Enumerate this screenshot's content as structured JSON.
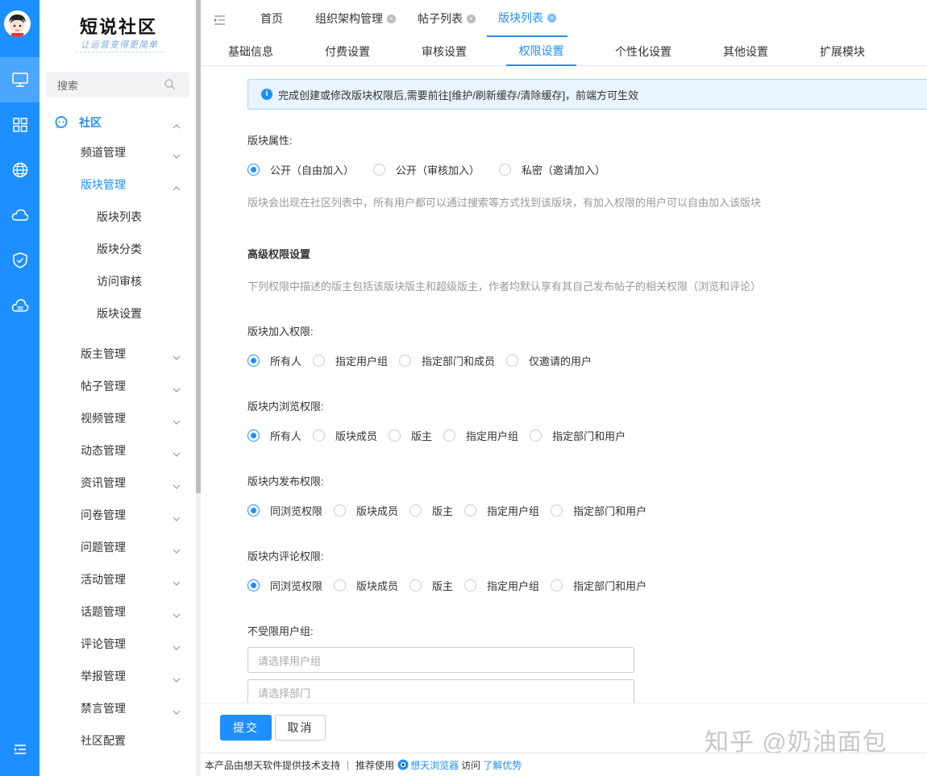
{
  "logo": {
    "title": "短说社区",
    "slogan": "让运营变得更简单"
  },
  "search": {
    "placeholder": "搜索"
  },
  "sidebar": {
    "section_label": "社区",
    "items": [
      {
        "label": "频道管理"
      },
      {
        "label": "版块管理"
      },
      {
        "label": "版块列表"
      },
      {
        "label": "版块分类"
      },
      {
        "label": "访问审核"
      },
      {
        "label": "版块设置"
      },
      {
        "label": "版主管理"
      },
      {
        "label": "帖子管理"
      },
      {
        "label": "视频管理"
      },
      {
        "label": "动态管理"
      },
      {
        "label": "资讯管理"
      },
      {
        "label": "问卷管理"
      },
      {
        "label": "问题管理"
      },
      {
        "label": "活动管理"
      },
      {
        "label": "话题管理"
      },
      {
        "label": "评论管理"
      },
      {
        "label": "举报管理"
      },
      {
        "label": "禁言管理"
      },
      {
        "label": "社区配置"
      }
    ]
  },
  "top_tabs": [
    {
      "label": "首页"
    },
    {
      "label": "组织架构管理"
    },
    {
      "label": "帖子列表"
    },
    {
      "label": "版块列表",
      "active": true
    }
  ],
  "sub_tabs": [
    {
      "label": "基础信息"
    },
    {
      "label": "付费设置"
    },
    {
      "label": "审核设置"
    },
    {
      "label": "权限设置",
      "active": true
    },
    {
      "label": "个性化设置"
    },
    {
      "label": "其他设置"
    },
    {
      "label": "扩展模块"
    }
  ],
  "notice": "完成创建或修改版块权限后,需要前往[维护/刷新缓存/清除缓存]，前端方可生效",
  "attr": {
    "label": "版块属性:",
    "options": [
      "公开（自由加入）",
      "公开（审核加入）",
      "私密（邀请加入）"
    ],
    "selected": 0,
    "hint": "版块会出现在社区列表中，所有用户都可以通过搜索等方式找到该版块，有加入权限的用户可以自由加入该版块"
  },
  "advanced": {
    "title": "高级权限设置",
    "hint": "下列权限中描述的版主包括该版块版主和超级版主，作者均默认享有其自己发布帖子的相关权限（浏览和评论）"
  },
  "join_perm": {
    "label": "版块加入权限:",
    "options": [
      "所有人",
      "指定用户组",
      "指定部门和成员",
      "仅邀请的用户"
    ],
    "selected": 0
  },
  "browse_perm": {
    "label": "版块内浏览权限:",
    "options": [
      "所有人",
      "版块成员",
      "版主",
      "指定用户组",
      "指定部门和用户"
    ],
    "selected": 0
  },
  "post_perm": {
    "label": "版块内发布权限:",
    "options": [
      "同浏览权限",
      "版块成员",
      "版主",
      "指定用户组",
      "指定部门和用户"
    ],
    "selected": 0
  },
  "comment_perm": {
    "label": "版块内评论权限:",
    "options": [
      "同浏览权限",
      "版块成员",
      "版主",
      "指定用户组",
      "指定部门和用户"
    ],
    "selected": 0
  },
  "unlimited": {
    "label": "不受限用户组:",
    "group_placeholder": "请选择用户组",
    "dept_placeholder": "请选择部门"
  },
  "buttons": {
    "submit": "提交",
    "cancel": "取消"
  },
  "footer": {
    "support": "本产品由想天软件提供技术支持",
    "recommend": "推荐使用",
    "browser": "想天浏览器",
    "visit": "访问",
    "learn": "了解优势"
  },
  "watermark": "知乎 @奶油面包",
  "colors": {
    "accent": "#1e8fff",
    "rail": "#1e8fff"
  }
}
